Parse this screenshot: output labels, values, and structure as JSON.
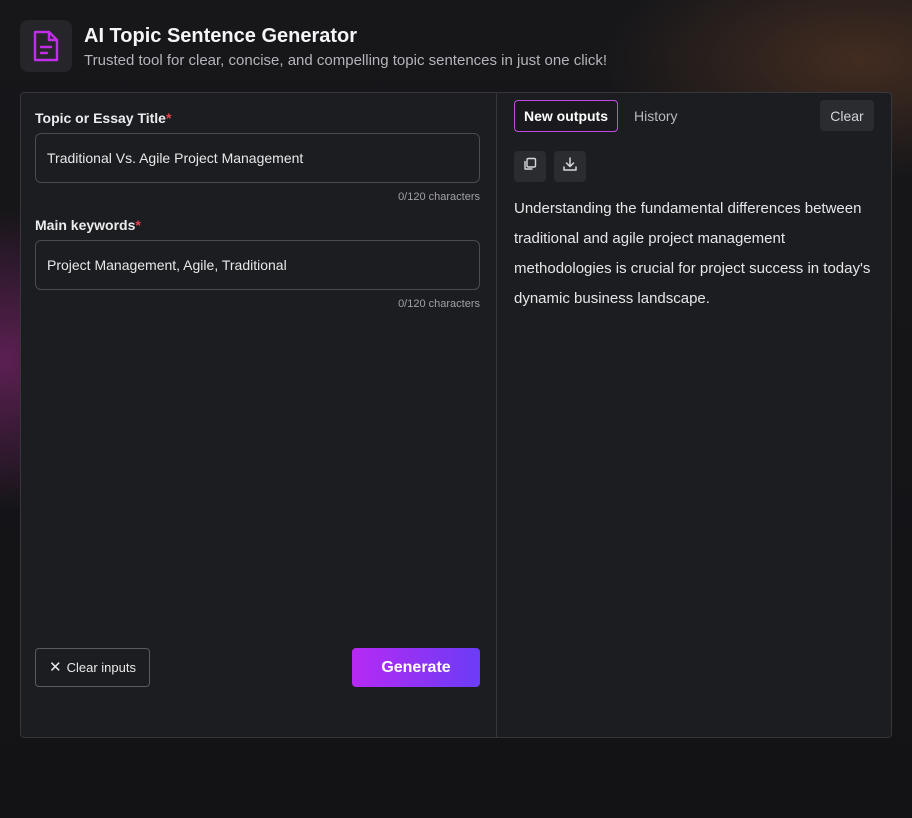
{
  "header": {
    "title": "AI Topic Sentence Generator",
    "subtitle": "Trusted tool for clear, concise, and compelling topic sentences in just one click!",
    "icon": "document-icon",
    "accent_color": "#c02ee8"
  },
  "form": {
    "topic": {
      "label": "Topic or Essay Title",
      "required_mark": "*",
      "value": "Traditional Vs. Agile Project Management",
      "char_count": "0/120 characters"
    },
    "keywords": {
      "label": "Main keywords",
      "required_mark": "*",
      "value": "Project Management, Agile, Traditional",
      "char_count": "0/120 characters"
    },
    "clear_inputs_label": "Clear inputs",
    "clear_icon": "close-icon",
    "generate_label": "Generate"
  },
  "output": {
    "tabs": [
      {
        "label": "New outputs",
        "active": true
      },
      {
        "label": "History",
        "active": false
      }
    ],
    "clear_label": "Clear",
    "copy_icon": "copy-icon",
    "download_icon": "download-icon",
    "text": "Understanding the fundamental differences between traditional and agile project management methodologies is crucial for project success in today's dynamic business landscape."
  }
}
